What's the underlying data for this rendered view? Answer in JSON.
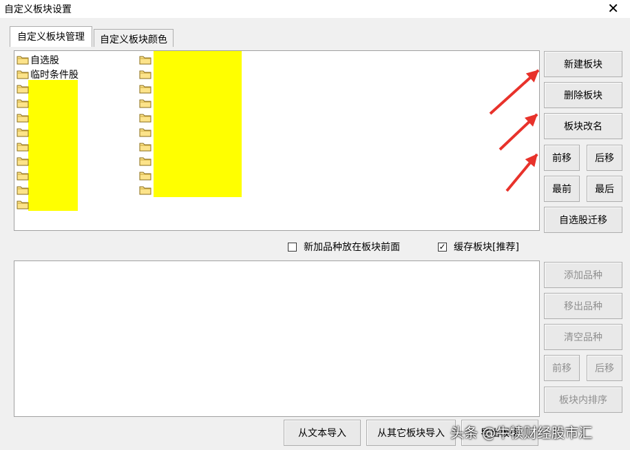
{
  "window": {
    "title": "自定义板块设置",
    "close_glyph": "✕"
  },
  "tabs": [
    {
      "label": "自定义板块管理",
      "active": true
    },
    {
      "label": "自定义板块颜色",
      "active": false
    }
  ],
  "block_list": {
    "col1": [
      {
        "label": "自选股"
      },
      {
        "label": "临时条件股"
      },
      {
        "label": ""
      },
      {
        "label": ""
      },
      {
        "label": ""
      },
      {
        "label": ""
      },
      {
        "label": ""
      },
      {
        "label": ""
      },
      {
        "label": ""
      },
      {
        "label": ""
      },
      {
        "label": ""
      }
    ],
    "col2": [
      {
        "label": ""
      },
      {
        "label": ""
      },
      {
        "label": ""
      },
      {
        "label": ""
      },
      {
        "label": ""
      },
      {
        "label": ""
      },
      {
        "label": ""
      },
      {
        "label": ""
      },
      {
        "label": ""
      },
      {
        "label": ""
      }
    ],
    "highlight_color": "#ffff00"
  },
  "block_buttons": {
    "new": "新建板块",
    "delete": "删除板块",
    "rename": "板块改名",
    "move_forward": "前移",
    "move_back": "后移",
    "move_first": "最前",
    "move_last": "最后",
    "migrate_watchlist": "自选股迁移"
  },
  "options": {
    "add_to_front": {
      "label": "新加品种放在板块前面",
      "checked": false
    },
    "cache_block": {
      "label": "缓存板块[推荐]",
      "checked": true
    }
  },
  "stock_buttons": {
    "add": "添加品种",
    "remove": "移出品种",
    "clear": "清空品种",
    "move_forward": "前移",
    "move_back": "后移",
    "sort_in_block": "板块内排序"
  },
  "bottom_buttons": {
    "import_text": "从文本导入",
    "import_other": "从其它板块导入",
    "export": "导出板块"
  },
  "annotation": {
    "arrow_color": "#e8322b"
  },
  "watermark": "头条 @牛犊财经股市汇"
}
